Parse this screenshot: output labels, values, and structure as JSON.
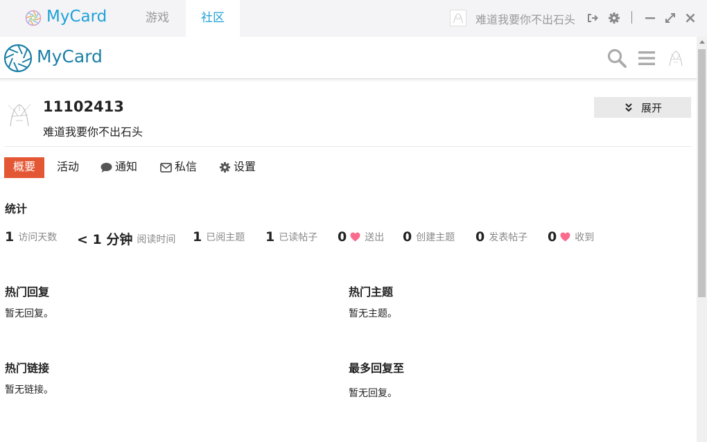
{
  "app": {
    "brand": "MyCard",
    "tabs": [
      {
        "label": "游戏"
      },
      {
        "label": "社区"
      }
    ],
    "username": "难道我要你不出石头"
  },
  "forum": {
    "brand": "MyCard"
  },
  "profile": {
    "user_id": "11102413",
    "user_title": "难道我要你不出石头",
    "expand_label": "展开"
  },
  "nav": {
    "items": [
      {
        "label": "概要"
      },
      {
        "label": "活动"
      },
      {
        "label": "通知"
      },
      {
        "label": "私信"
      },
      {
        "label": "设置"
      }
    ]
  },
  "stats": {
    "title": "统计",
    "items": [
      {
        "value": "1",
        "label": "访问天数"
      },
      {
        "value": "< 1 分钟",
        "label": "阅读时间"
      },
      {
        "value": "1",
        "label": "已阅主题"
      },
      {
        "value": "1",
        "label": "已读帖子"
      },
      {
        "value": "0",
        "label": "送出",
        "icon": "heart-icon"
      },
      {
        "value": "0",
        "label": "创建主题"
      },
      {
        "value": "0",
        "label": "发表帖子"
      },
      {
        "value": "0",
        "label": "收到",
        "icon": "heart-icon"
      }
    ]
  },
  "sections": {
    "top_replies": {
      "title": "热门回复",
      "empty": "暂无回复。"
    },
    "top_topics": {
      "title": "热门主题",
      "empty": "暂无主题。"
    },
    "top_links": {
      "title": "热门链接",
      "empty": "暂无链接。"
    },
    "most_replied_to": {
      "title": "最多回复至",
      "empty": "暂无回复。"
    }
  },
  "colors": {
    "accent": "#1ea1d8",
    "brand_dark": "#1a7fa6",
    "active_nav": "#e45735",
    "heart": "#fa6c8d"
  }
}
